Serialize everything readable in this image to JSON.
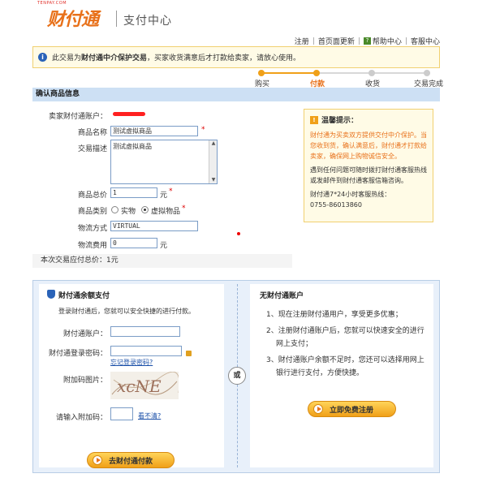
{
  "header": {
    "logo_small": "TENPAY.COM",
    "logo_text": "财付通",
    "logo_sub": "支付中心",
    "links": [
      "注册",
      "首页面更新",
      "帮助中心",
      "客服中心"
    ],
    "help_icon": "question-icon"
  },
  "notice": {
    "prefix": "此交易为",
    "bold": "财付通中介保护交易",
    "suffix": "，买家收货满意后才打款给卖家，请放心使用。"
  },
  "steps": [
    {
      "label": "购买",
      "active": false
    },
    {
      "label": "付款",
      "active": true
    },
    {
      "label": "收货",
      "active": false
    },
    {
      "label": "交易完成",
      "active": false
    }
  ],
  "section_title": "确认商品信息",
  "form": {
    "seller_label": "卖家财付通账户：",
    "name_label": "商品名称",
    "name_value": "测试虚拟商品",
    "desc_label": "交易描述",
    "desc_value": "测试虚拟商品",
    "price_label": "商品总价",
    "price_value": "1",
    "price_unit": "元",
    "type_label": "商品类别",
    "type_options": [
      "实物",
      "虚拟物品"
    ],
    "shipping_label": "物流方式",
    "shipping_value": "VIRTUAL",
    "fee_label": "物流费用",
    "fee_value": "0",
    "fee_unit": "元",
    "required": "*",
    "total_text": "本次交易应付总价：1元"
  },
  "tips": {
    "title": "温馨提示：",
    "items": [
      "财付通为买卖双方提供交付中介保护。当您收到货，确认满意后，财付通才打款给卖家，确保网上购物诚信安全。",
      "遇到任何问题可随时拨打财付通客服热线或发邮件到财付通客服信箱咨询。",
      "财付通7*24小时客服热线：",
      "0755-86013860"
    ]
  },
  "pay_left": {
    "title": "财付通余额支付",
    "intro": "登录财付通后，您就可以安全快捷的进行付款。",
    "account_label": "财付通账户：",
    "password_label": "财付通登录密码：",
    "forgot": "忘记登录密码?",
    "captcha_label": "附加码图片：",
    "captcha_text": "xcNE",
    "captcha_input_label": "请输入附加码：",
    "refresh": "看不清?",
    "button": "去财付通付款"
  },
  "or_text": "或",
  "pay_right": {
    "title": "无财付通账户",
    "items": [
      "1、现在注册财付通用户，享受更多优惠；",
      "2、注册财付通账户后，您就可以快速安全的进行",
      "网上支付；",
      "3、财付通账户余额不足时，您还可以选择用网上",
      "银行进行支付，方便快捷。"
    ],
    "button": "立即免费注册"
  }
}
